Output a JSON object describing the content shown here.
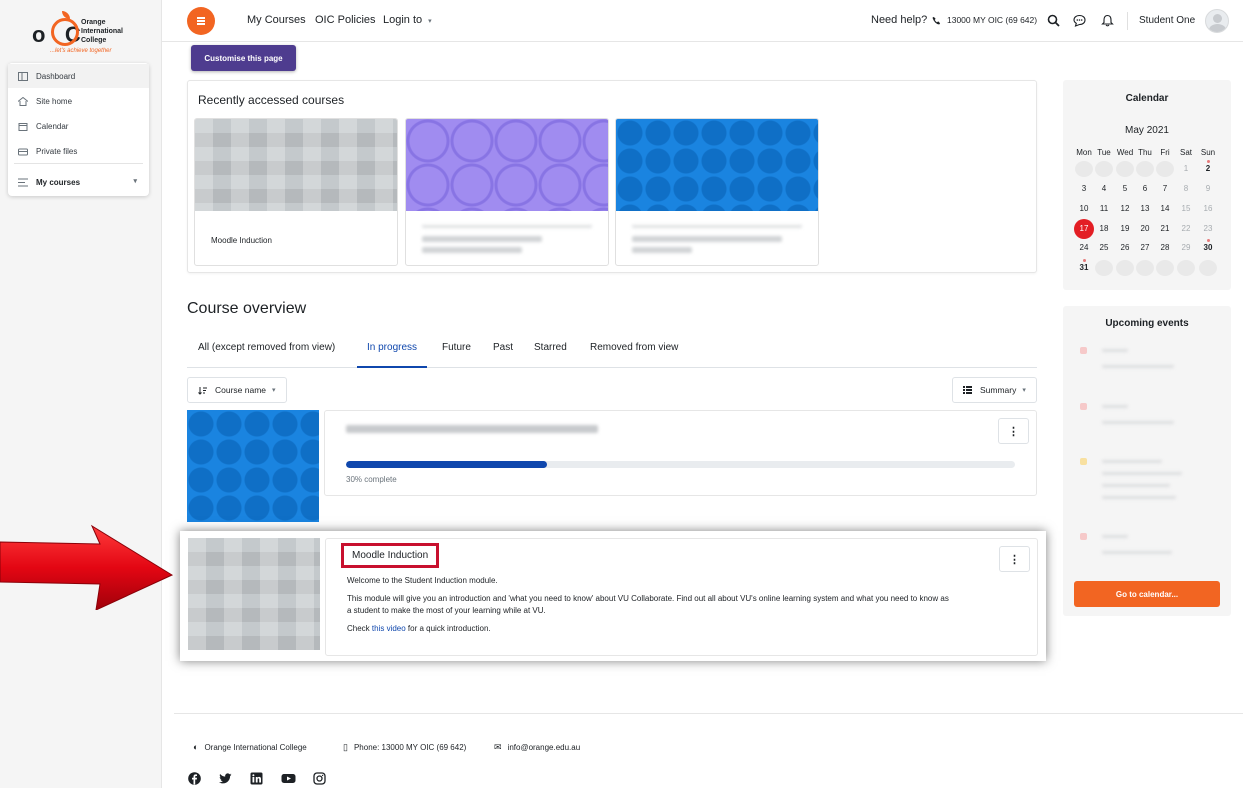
{
  "brand": {
    "name_line1": "Orange",
    "name_line2": "International",
    "name_line3": "College",
    "tagline": "...let's achieve together",
    "accent": "#f26522"
  },
  "drawer": {
    "items": [
      {
        "label": "Dashboard",
        "icon": "dashboard-icon"
      },
      {
        "label": "Site home",
        "icon": "home-icon"
      },
      {
        "label": "Calendar",
        "icon": "calendar-icon"
      },
      {
        "label": "Private files",
        "icon": "folder-icon"
      },
      {
        "label": "My courses",
        "icon": "list-icon"
      }
    ]
  },
  "topbar": {
    "nav": [
      "My Courses",
      "OIC Policies",
      "Login to"
    ],
    "help_label": "Need help?",
    "phone": "13000 MY OIC (69 642)",
    "user_name": "Student One"
  },
  "customise_label": "Customise this page",
  "recent": {
    "title": "Recently accessed courses",
    "courses": [
      {
        "name": "Moodle Induction"
      },
      {
        "name": ""
      },
      {
        "name": ""
      }
    ]
  },
  "overview": {
    "title": "Course overview",
    "tabs": [
      "All (except removed from view)",
      "In progress",
      "Future",
      "Past",
      "Starred",
      "Removed from view"
    ],
    "active_tab": "In progress",
    "sort_label": "Course name",
    "view_label": "Summary",
    "course1": {
      "progress": 30,
      "progress_text": "30% complete"
    },
    "course2": {
      "title": "Moodle Induction",
      "line1": "Welcome to the Student Induction module.",
      "line2": "This module will give you an introduction and 'what you need to know' about VU Collaborate. Find out all about VU's online learning system and what you need to know as",
      "line3": "a student to make the most of your learning while at VU.",
      "line4_pre": "Check ",
      "line4_link": "this video",
      "line4_post": " for a quick introduction."
    }
  },
  "calendar": {
    "title": "Calendar",
    "month": "May 2021",
    "day_names": [
      "Mon",
      "Tue",
      "Wed",
      "Thu",
      "Fri",
      "Sat",
      "Sun"
    ],
    "weeks": [
      [
        "",
        "",
        "",
        "",
        "",
        "1",
        "2"
      ],
      [
        "3",
        "4",
        "5",
        "6",
        "7",
        "8",
        "9"
      ],
      [
        "10",
        "11",
        "12",
        "13",
        "14",
        "15",
        "16"
      ],
      [
        "17",
        "18",
        "19",
        "20",
        "21",
        "22",
        "23"
      ],
      [
        "24",
        "25",
        "26",
        "27",
        "28",
        "29",
        "30"
      ],
      [
        "31",
        "",
        "",
        "",
        "",
        "",
        ""
      ]
    ],
    "today": "17"
  },
  "upcoming": {
    "title": "Upcoming events",
    "go_label": "Go to calendar..."
  },
  "footer": {
    "org": "Orange International College",
    "phone": "Phone: 13000 MY OIC (69 642)",
    "email": "info@orange.edu.au"
  }
}
